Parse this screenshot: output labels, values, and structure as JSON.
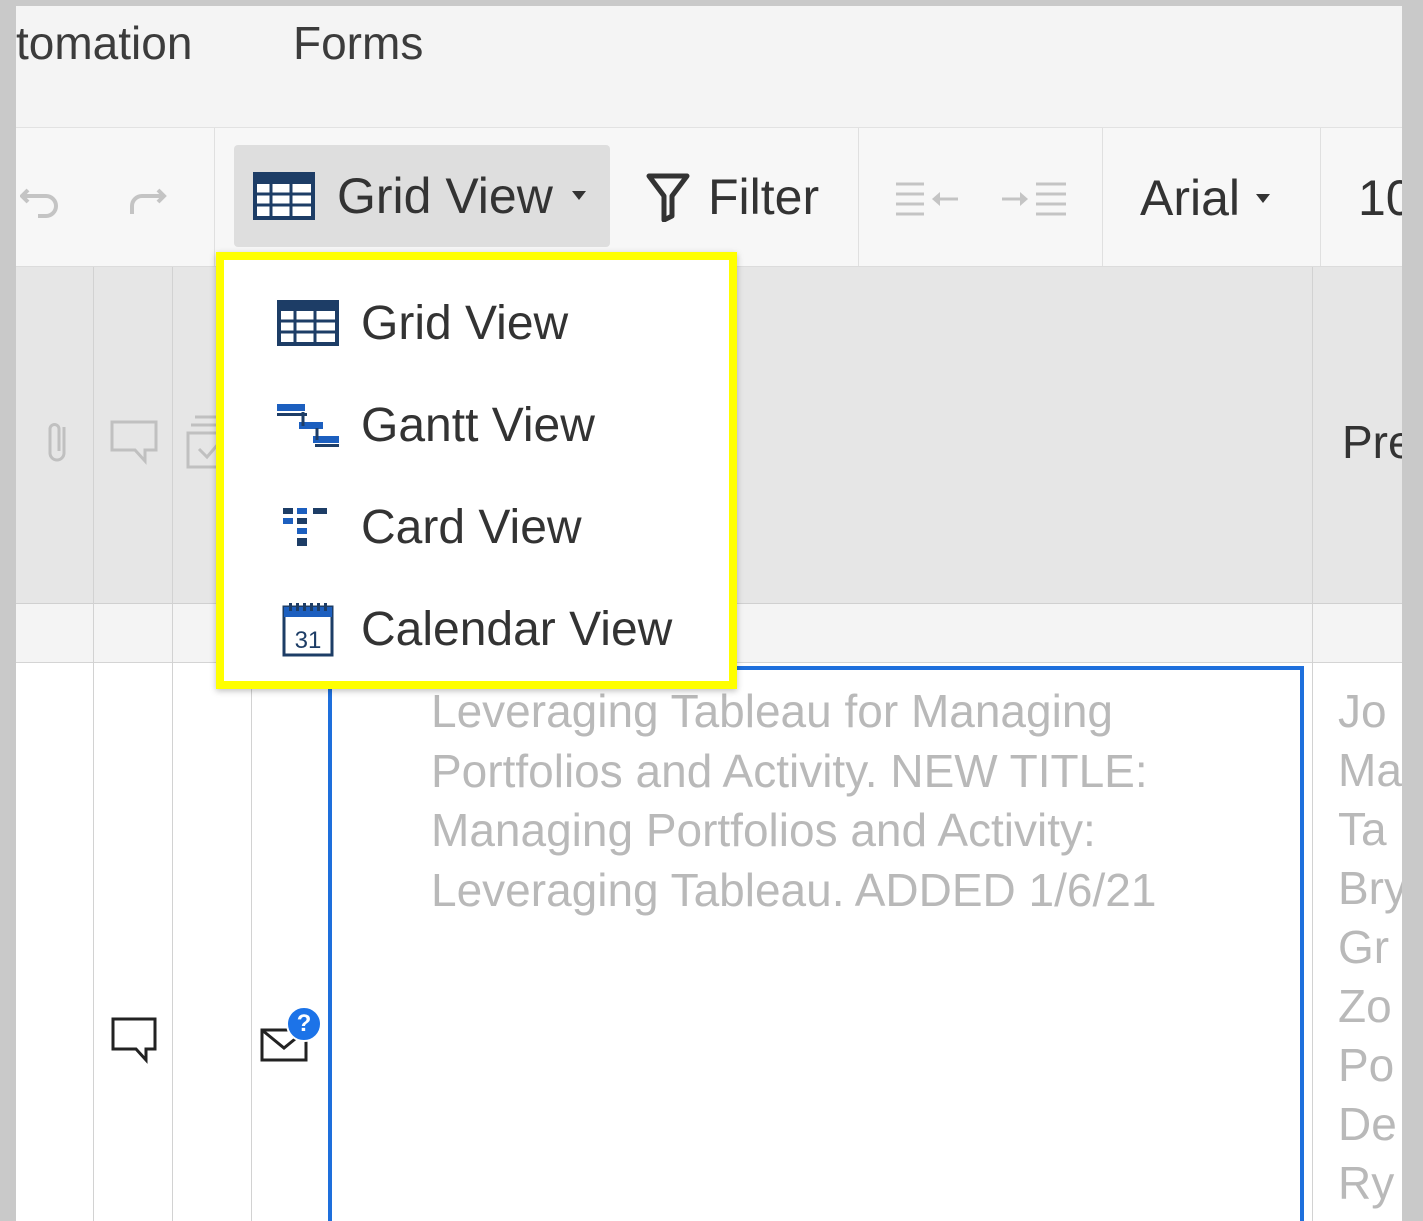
{
  "menu": {
    "items": [
      {
        "label": "tomation"
      },
      {
        "label": "Forms"
      }
    ]
  },
  "toolbar": {
    "view_button_label": "Grid View",
    "filter_label": "Filter",
    "font_label": "Arial",
    "font_size_partial": "10"
  },
  "view_menu": {
    "items": [
      {
        "label": "Grid View",
        "icon": "grid-view-icon"
      },
      {
        "label": "Gantt View",
        "icon": "gantt-view-icon"
      },
      {
        "label": "Card View",
        "icon": "card-view-icon"
      },
      {
        "label": "Calendar View",
        "icon": "calendar-view-icon",
        "icon_text": "31"
      }
    ]
  },
  "grid": {
    "predecessors_header_partial": "Pre",
    "row": {
      "task_lines": [
        "Leveraging Tableau for Managing",
        "Portfolios and Activity. NEW TITLE:",
        "Managing Portfolios and Activity:",
        "Leveraging Tableau. ADDED 1/6/21"
      ],
      "names_partial": [
        "Jo",
        "Ma",
        "Ta",
        "Bry",
        "Gr",
        "Zo",
        "Po",
        "De",
        "Ry"
      ],
      "badge": "?"
    }
  },
  "colors": {
    "highlight": "#ffff00",
    "selection": "#1e6fdc",
    "icon_blue": "#1c5fbf"
  }
}
